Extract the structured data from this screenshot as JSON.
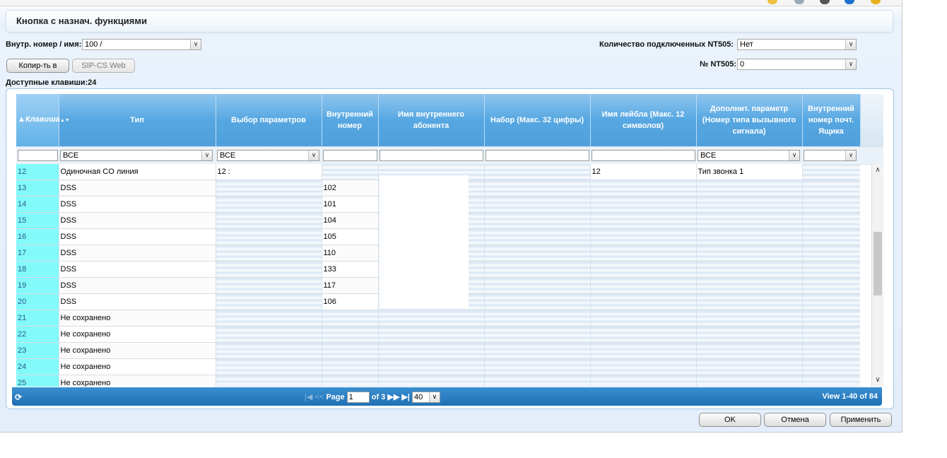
{
  "title": "Кнопка с назнач. функциями",
  "extension": {
    "label": "Внутр. номер / имя:",
    "value": "100 /"
  },
  "nt505_count": {
    "label": "Количество подключенных NT505:",
    "value": "Нет"
  },
  "nt505_no": {
    "label": "№ NT505:",
    "value": "0"
  },
  "buttons": {
    "copy_to": "Копир-ть в",
    "sip_cs_web": "SIP-CS Web"
  },
  "available_keys": "Доступные клавиши:24",
  "columns": [
    {
      "label": "Клавиша",
      "sort": "▲▼"
    },
    {
      "label": "Тип"
    },
    {
      "label": "Выбор параметров"
    },
    {
      "label": "Внутренний номер"
    },
    {
      "label": "Имя внутреннего абонента"
    },
    {
      "label": "Набор (Макс. 32 цифры)"
    },
    {
      "label": "Имя лейбла (Макс. 12 символов)"
    },
    {
      "label": "Дополнит. параметр (Номер типа вызывного сигнала)"
    },
    {
      "label": "Внутренний номер почт. Ящика"
    }
  ],
  "filters": {
    "type": "ВСЕ",
    "params": "ВСЕ",
    "extra": "ВСЕ",
    "mailbox": ""
  },
  "rows": [
    {
      "key": "12",
      "type": "Одиночная CO линия",
      "param": "12 :",
      "ext": "",
      "label": "12",
      "extra": "Тип звонка 1"
    },
    {
      "key": "13",
      "type": "DSS",
      "param": "",
      "ext": "102",
      "label": "",
      "extra": ""
    },
    {
      "key": "14",
      "type": "DSS",
      "param": "",
      "ext": "101",
      "label": "",
      "extra": ""
    },
    {
      "key": "15",
      "type": "DSS",
      "param": "",
      "ext": "104",
      "label": "",
      "extra": ""
    },
    {
      "key": "16",
      "type": "DSS",
      "param": "",
      "ext": "105",
      "label": "",
      "extra": ""
    },
    {
      "key": "17",
      "type": "DSS",
      "param": "",
      "ext": "110",
      "label": "",
      "extra": ""
    },
    {
      "key": "18",
      "type": "DSS",
      "param": "",
      "ext": "133",
      "label": "",
      "extra": ""
    },
    {
      "key": "19",
      "type": "DSS",
      "param": "",
      "ext": "117",
      "label": "",
      "extra": ""
    },
    {
      "key": "20",
      "type": "DSS",
      "param": "",
      "ext": "106",
      "label": "",
      "extra": ""
    },
    {
      "key": "21",
      "type": "Не сохранено",
      "param": "",
      "ext": "",
      "label": "",
      "extra": ""
    },
    {
      "key": "22",
      "type": "Не сохранено",
      "param": "",
      "ext": "",
      "label": "",
      "extra": ""
    },
    {
      "key": "23",
      "type": "Не сохранено",
      "param": "",
      "ext": "",
      "label": "",
      "extra": ""
    },
    {
      "key": "24",
      "type": "Не сохранено",
      "param": "",
      "ext": "",
      "label": "",
      "extra": ""
    },
    {
      "key": "25",
      "type": "Не сохранено",
      "param": "",
      "ext": "",
      "label": "",
      "extra": ""
    }
  ],
  "pager": {
    "page_label": "Page",
    "page_value": "1",
    "of_label": "of 3",
    "rows_per_page": "40",
    "view": "View 1-40 of 84"
  },
  "footer": {
    "ok": "OK",
    "cancel": "Отмена",
    "apply": "Применить"
  }
}
